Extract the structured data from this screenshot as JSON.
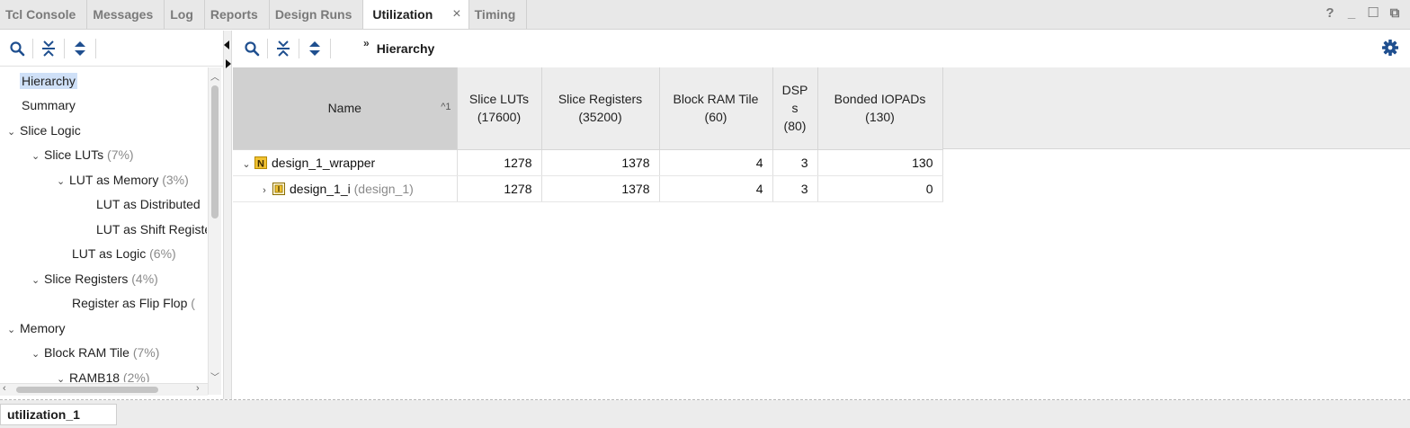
{
  "tabs": [
    {
      "label": "Tcl Console",
      "active": false
    },
    {
      "label": "Messages",
      "active": false
    },
    {
      "label": "Log",
      "active": false
    },
    {
      "label": "Reports",
      "active": false
    },
    {
      "label": "Design Runs",
      "active": false
    },
    {
      "label": "Utilization",
      "active": true
    },
    {
      "label": "Timing",
      "active": false
    }
  ],
  "window_controls": {
    "help": "?",
    "minimize": "_",
    "maximize": "☐",
    "float": "⧉"
  },
  "tree": [
    {
      "label": "Hierarchy",
      "pct": "",
      "selected": true
    },
    {
      "label": "Summary",
      "pct": ""
    },
    {
      "label": "Slice Logic",
      "pct": "",
      "chevron": "⌄"
    },
    {
      "label": "Slice LUTs",
      "pct": "(7%)",
      "chevron": "⌄"
    },
    {
      "label": "LUT as Memory",
      "pct": "(3%)",
      "chevron": "⌄"
    },
    {
      "label": "LUT as Distributed",
      "pct": ""
    },
    {
      "label": "LUT as Shift Register",
      "pct": ""
    },
    {
      "label": "LUT as Logic",
      "pct": "(6%)"
    },
    {
      "label": "Slice Registers",
      "pct": "(4%)",
      "chevron": "⌄"
    },
    {
      "label": "Register as Flip Flop",
      "pct": "("
    },
    {
      "label": "Memory",
      "pct": "",
      "chevron": "⌄"
    },
    {
      "label": "Block RAM Tile",
      "pct": "(7%)",
      "chevron": "⌄"
    },
    {
      "label": "RAMB18",
      "pct": "(2%)",
      "chevron": "⌄"
    }
  ],
  "breadcrumb": {
    "chevrons": "»",
    "title": "Hierarchy"
  },
  "table": {
    "headers": {
      "name": "Name",
      "sort_indicator": "^1",
      "luts": [
        "Slice LUTs",
        "(17600)"
      ],
      "regs": [
        "Slice Registers",
        "(35200)"
      ],
      "bram": [
        "Block RAM Tile",
        "(60)"
      ],
      "dsp": [
        "DSP",
        "s",
        "(80)"
      ],
      "iopads": [
        "Bonded IOPADs",
        "(130)"
      ]
    },
    "rows": [
      {
        "chevron": "⌄",
        "name": "design_1_wrapper",
        "instance": "",
        "luts": "1278",
        "regs": "1378",
        "bram": "4",
        "dsp": "3",
        "iopads": "130"
      },
      {
        "chevron": "›",
        "name": "design_1_i",
        "instance": "(design_1)",
        "luts": "1278",
        "regs": "1378",
        "bram": "4",
        "dsp": "3",
        "iopads": "0"
      }
    ]
  },
  "bottom_tab": {
    "label": "utilization_1"
  },
  "colors": {
    "accent": "#1f4f8f",
    "selection": "#cfe0f7",
    "wrapper_icon": "#e0b000"
  }
}
